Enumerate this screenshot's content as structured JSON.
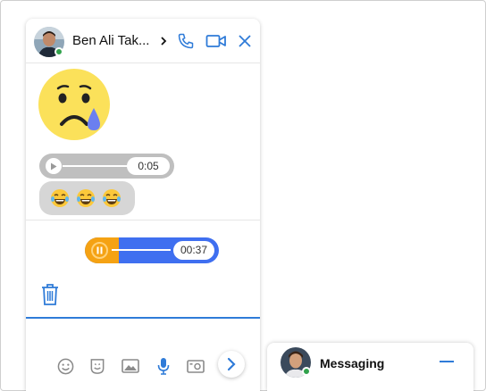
{
  "chat": {
    "contact_name": "Ben Ali Tak...",
    "status": "online",
    "messages": {
      "audio": {
        "duration": "0:05"
      },
      "emoji_reactions": [
        "laughing-with-tears",
        "laughing-with-tears",
        "laughing-with-tears"
      ],
      "sticker": "sad-face-with-tear"
    },
    "recording": {
      "duration": "00:37",
      "progress": 0.25
    },
    "composer": {
      "value": "",
      "placeholder": ""
    },
    "toolbar": [
      "emoji-icon",
      "sticker-icon",
      "image-icon",
      "microphone-icon",
      "camera-icon"
    ]
  },
  "dock": {
    "title": "Messaging"
  },
  "colors": {
    "accent": "#2f7bd8",
    "recording_bar": "#3f6ff0",
    "recording_progress": "#f5a213",
    "online": "#31a24c",
    "audio_bubble": "#bfbfbf",
    "emoji_bubble": "#d6d6d6"
  }
}
